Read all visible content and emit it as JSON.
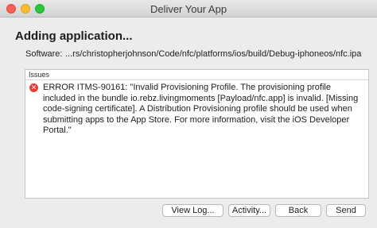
{
  "window": {
    "title": "Deliver Your App"
  },
  "heading": "Adding application...",
  "software": {
    "label": "Software:",
    "path": "...rs/christopherjohnson/Code/nfc/platforms/ios/build/Debug-iphoneos/nfc.ipa"
  },
  "issues": {
    "header": "Issues",
    "items": [
      {
        "severity": "error",
        "icon": "error-x-icon",
        "text": "ERROR ITMS-90161: \"Invalid Provisioning Profile. The provisioning profile included in the bundle io.rebz.livingmoments [Payload/nfc.app] is invalid. [Missing code-signing certificate]. A Distribution Provisioning profile should be used when submitting apps to the App Store. For more information, visit the iOS Developer Portal.\""
      }
    ]
  },
  "buttons": {
    "view_log": "View Log...",
    "activity": "Activity...",
    "back": "Back",
    "send": "Send"
  },
  "colors": {
    "error": "#ec3a35",
    "traffic_close": "#fc5f57",
    "traffic_minimize": "#fdbc2e",
    "traffic_maximize": "#28c840"
  }
}
